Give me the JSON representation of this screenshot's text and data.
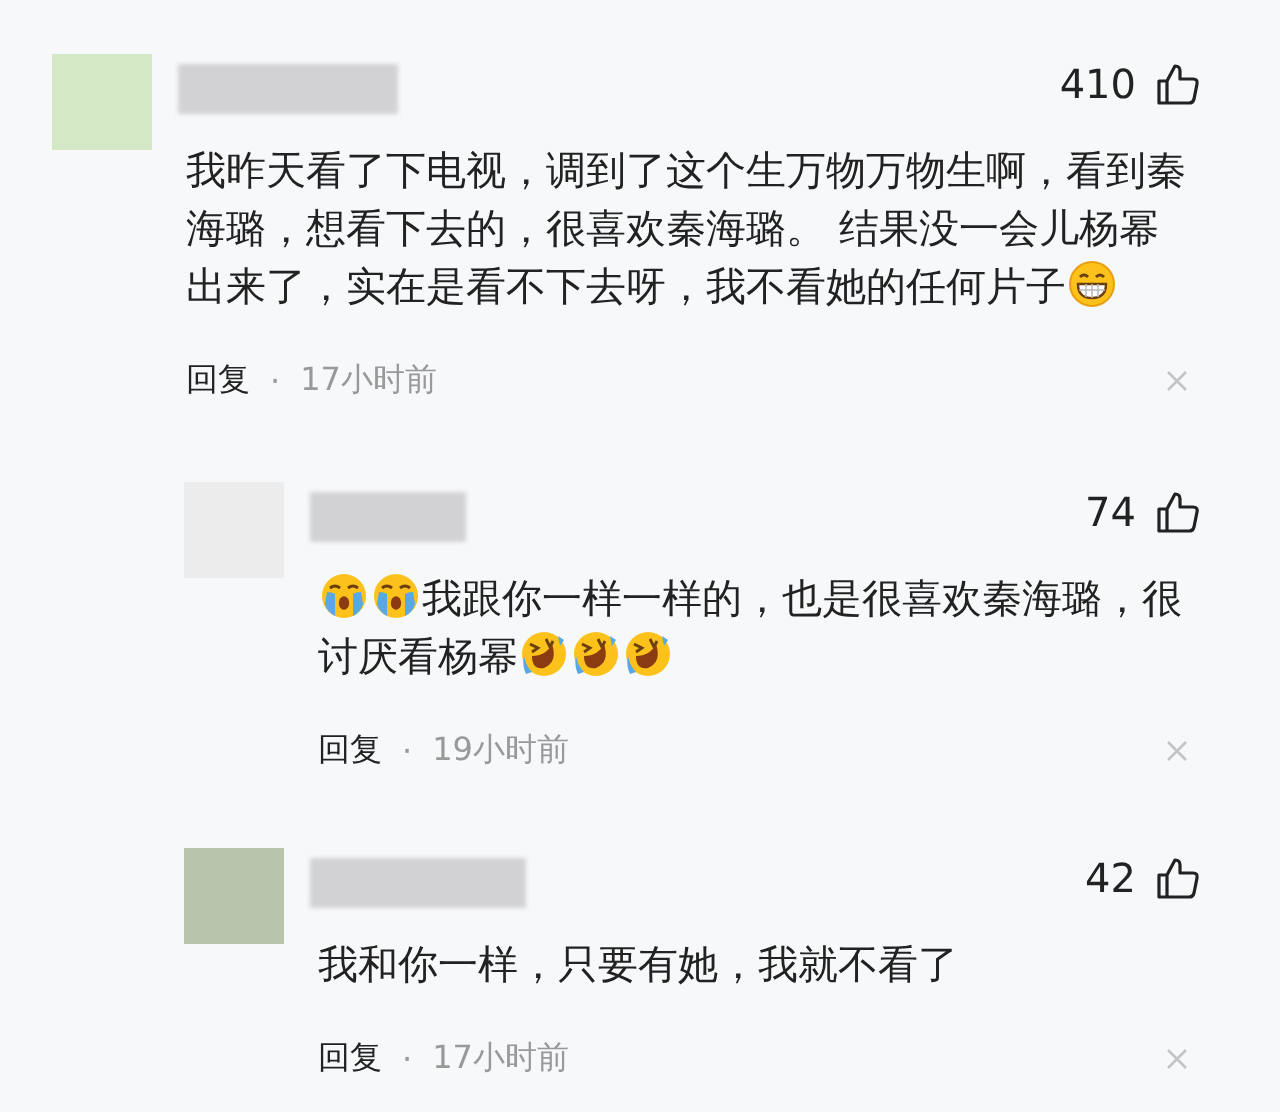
{
  "comments": [
    {
      "color": "#d5e8c6",
      "likes": "410",
      "content": [
        {
          "kind": "text",
          "text": "我昨天看了下电视，调到了这个生万物万物生啊，看到秦海璐，想看下去的，很喜欢秦海璐。 结果没一会儿杨幂出来了，实在是看不下去呀，我不看她的任何片子"
        },
        {
          "kind": "grin-emoji"
        }
      ],
      "reply_label": "回复",
      "separator": "·",
      "time": "17小时前",
      "replies": [
        {
          "color": "#ececec",
          "likes": "74",
          "content": [
            {
              "kind": "crying-emoji"
            },
            {
              "kind": "crying-emoji"
            },
            {
              "kind": "text",
              "text": "我跟你一样一样的，也是很喜欢秦海璐，很讨厌看杨幂"
            },
            {
              "kind": "laughing-emoji"
            },
            {
              "kind": "laughing-emoji"
            },
            {
              "kind": "laughing-emoji"
            }
          ],
          "reply_label": "回复",
          "separator": "·",
          "time": "19小时前"
        },
        {
          "color": "#b9c4ac",
          "likes": "42",
          "content": [
            {
              "kind": "text",
              "text": "我和你一样，只要有她，我就不看了"
            }
          ],
          "reply_label": "回复",
          "separator": "·",
          "time": "17小时前"
        }
      ]
    }
  ]
}
